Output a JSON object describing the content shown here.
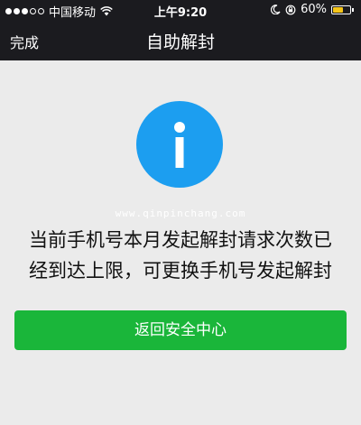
{
  "status_bar": {
    "carrier": "中国移动",
    "time": "上午9:20",
    "battery_percent_label": "60%",
    "battery_level": 0.6,
    "battery_color": "#f5c518"
  },
  "nav": {
    "back_label": "完成",
    "title": "自助解封"
  },
  "info_icon": {
    "icon": "info-icon",
    "color": "#1c9ef0"
  },
  "watermark": "www.qinpinchang.com",
  "message": {
    "line1": "当前手机号本月发起解封请求次数已",
    "line2": "经到达上限，可更换手机号发起解封"
  },
  "button": {
    "label": "返回安全中心",
    "color": "#1ab63a"
  }
}
